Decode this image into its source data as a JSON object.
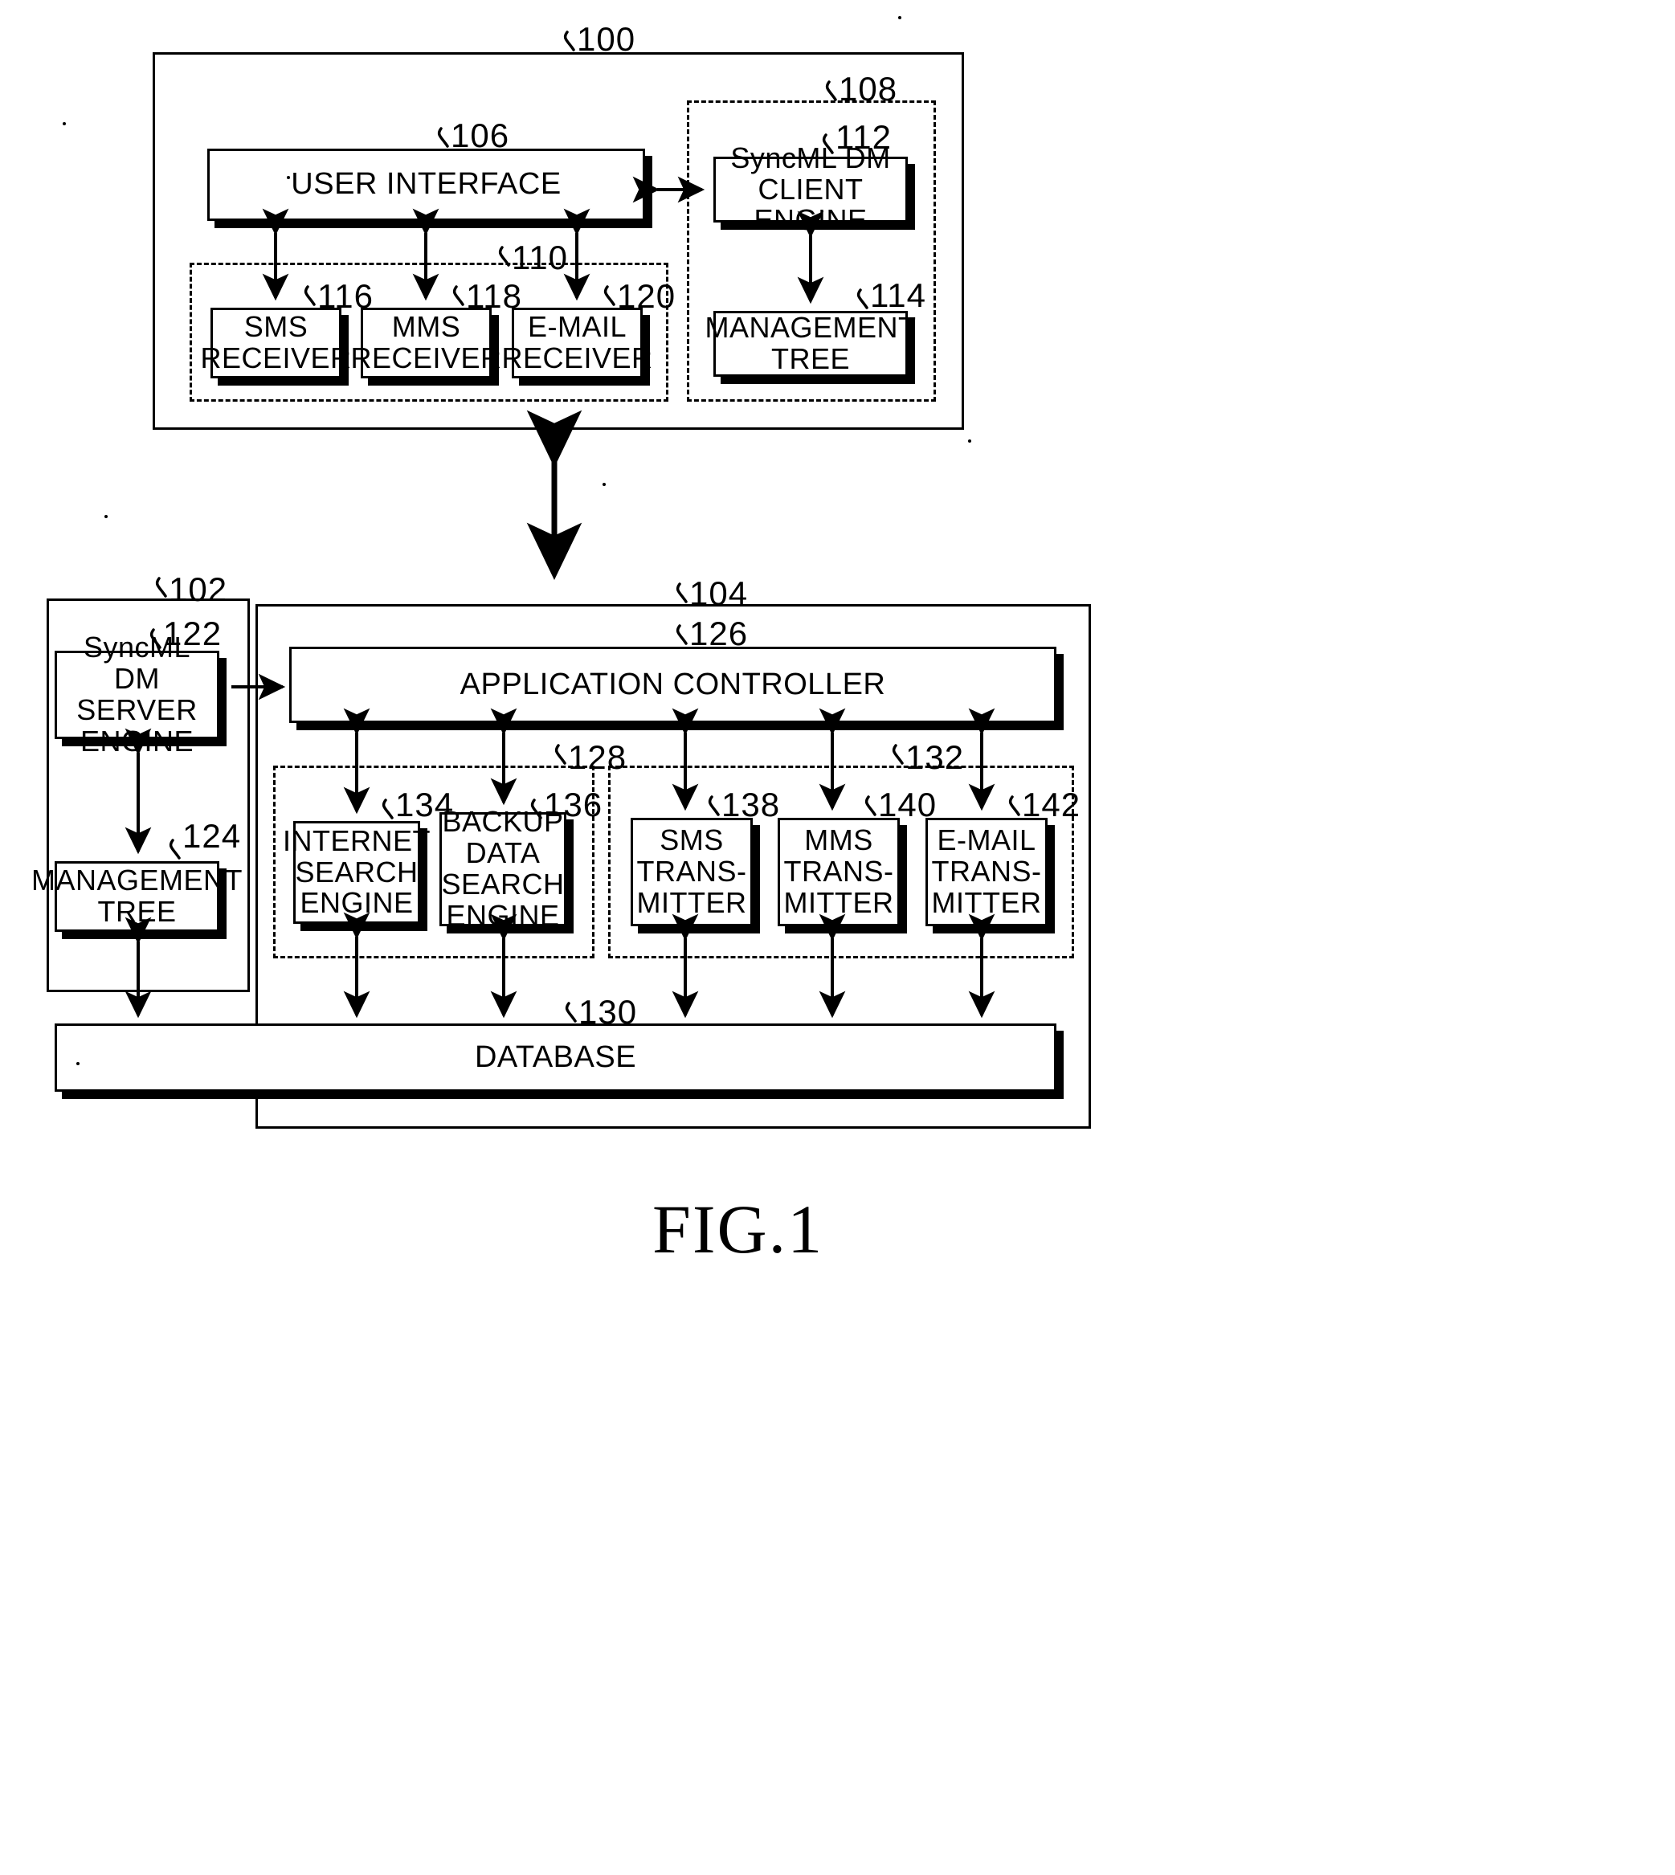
{
  "figure": {
    "caption": "FIG.1",
    "type": "patent-block-diagram"
  },
  "client": {
    "ref": "100",
    "user_interface": {
      "ref": "106",
      "label": "USER INTERFACE"
    },
    "dm_client_group": {
      "ref": "108"
    },
    "dm_client_engine": {
      "ref": "112",
      "label": "SyncML DM\nCLIENT ENGINE"
    },
    "management_tree": {
      "ref": "114",
      "label": "MANAGEMENT\nTREE"
    },
    "receiver_group": {
      "ref": "110"
    },
    "receivers": [
      {
        "ref": "116",
        "label": "SMS\nRECEIVER"
      },
      {
        "ref": "118",
        "label": "MMS\nRECEIVER"
      },
      {
        "ref": "120",
        "label": "E-MAIL\nRECEIVER"
      }
    ]
  },
  "dm_server": {
    "ref": "102",
    "server_engine": {
      "ref": "122",
      "label": "SyncML DM\nSERVER\nENGINE"
    },
    "management_tree": {
      "ref": "124",
      "label": "MANAGEMENT\nTREE"
    }
  },
  "app_server": {
    "ref": "104",
    "application_controller": {
      "ref": "126",
      "label": "APPLICATION CONTROLLER"
    },
    "search_group": {
      "ref": "128"
    },
    "search_engines": [
      {
        "ref": "134",
        "label": "INTERNET\nSEARCH\nENGINE"
      },
      {
        "ref": "136",
        "label": "BACKUP\nDATA\nSEARCH\nENGINE"
      }
    ],
    "transmitter_group": {
      "ref": "132"
    },
    "transmitters": [
      {
        "ref": "138",
        "label": "SMS\nTRANS-\nMITTER"
      },
      {
        "ref": "140",
        "label": "MMS\nTRANS-\nMITTER"
      },
      {
        "ref": "142",
        "label": "E-MAIL\nTRANS-\nMITTER"
      }
    ],
    "database": {
      "ref": "130",
      "label": "DATABASE"
    }
  },
  "colors": {
    "line": "#000000",
    "background": "#ffffff"
  }
}
